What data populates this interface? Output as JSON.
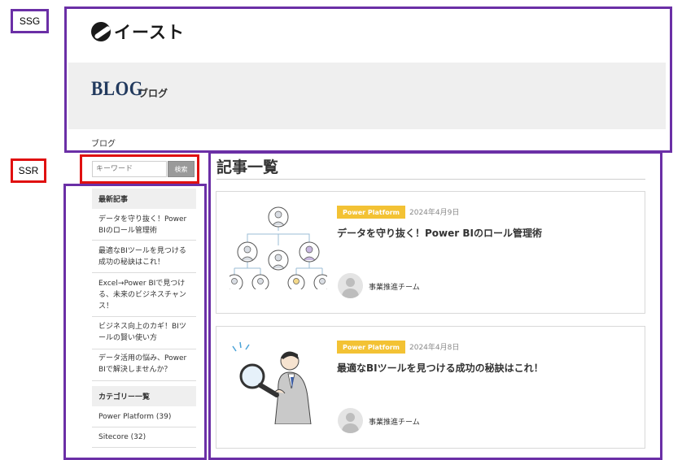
{
  "annotations": {
    "ssg_label": "SSG",
    "ssr_label": "SSR"
  },
  "header": {
    "logo_text": "イースト",
    "blog_word": "BLOG",
    "blog_sub": "ブログ",
    "breadcrumb": "ブログ"
  },
  "search": {
    "placeholder": "キーワード",
    "button_label": "検索"
  },
  "sidebar": {
    "recent_heading": "最新記事",
    "recent_items": [
      {
        "label": "データを守り抜く！Power BIのロール管理術"
      },
      {
        "label": "最適なBIツールを見つける成功の秘訣はこれ！"
      },
      {
        "label": "Excel→Power BIで見つける、未来のビジネスチャンス！"
      },
      {
        "label": "ビジネス向上のカギ！BIツールの賢い使い方"
      },
      {
        "label": "データ活用の悩み、Power BIで解決しませんか？"
      }
    ],
    "category_heading": "カテゴリー一覧",
    "categories": [
      {
        "label": "Power Platform (39)"
      },
      {
        "label": "Sitecore (32)"
      }
    ]
  },
  "main": {
    "title": "記事一覧",
    "articles": [
      {
        "category": "Power Platform",
        "date": "2024年4月9日",
        "title": "データを守り抜く！Power BIのロール管理術",
        "author": "事業推進チーム",
        "thumb_icon": "org-chart-people-illustration"
      },
      {
        "category": "Power Platform",
        "date": "2024年4月8日",
        "title": "最適なBIツールを見つける成功の秘訣はこれ！",
        "author": "事業推進チーム",
        "thumb_icon": "man-with-magnifier-illustration"
      }
    ]
  },
  "colors": {
    "annotation_purple": "#6b2fa6",
    "annotation_red": "#e01010",
    "category_badge": "#f3c234",
    "blog_word": "#223a5e"
  }
}
